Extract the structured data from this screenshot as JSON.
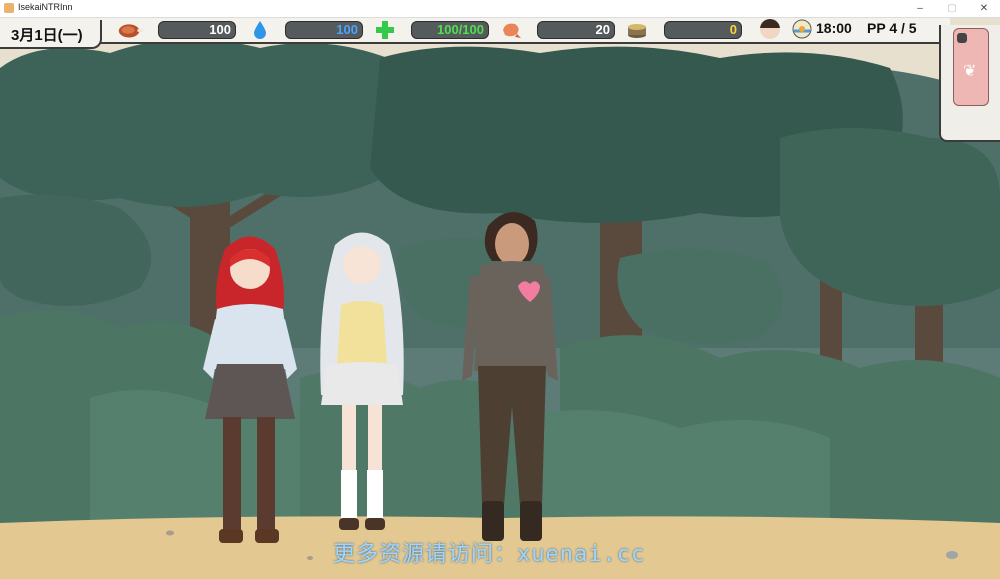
{
  "window": {
    "title": "IsekaiNTRInn"
  },
  "hud": {
    "date": "3月1日(一)",
    "stats": [
      {
        "icon": "meat-icon",
        "value": "100",
        "color": "#ffffff"
      },
      {
        "icon": "water-drop-icon",
        "value": "100",
        "color": "#4aa3ff"
      },
      {
        "icon": "health-cross-icon",
        "value": "100/100",
        "color": "#4fe04f"
      },
      {
        "icon": "shrimp-icon",
        "value": "20",
        "color": "#ffffff"
      },
      {
        "icon": "coin-stack-icon",
        "value": "0",
        "color": "#ffd23c"
      }
    ],
    "time": "18:00",
    "pp": "PP 4 / 5"
  },
  "characters": [
    {
      "name": "red-haired-girl"
    },
    {
      "name": "silver-haired-girl"
    },
    {
      "name": "brown-haired-man"
    }
  ],
  "watermark": "更多资源请访问：xuenai.cc"
}
